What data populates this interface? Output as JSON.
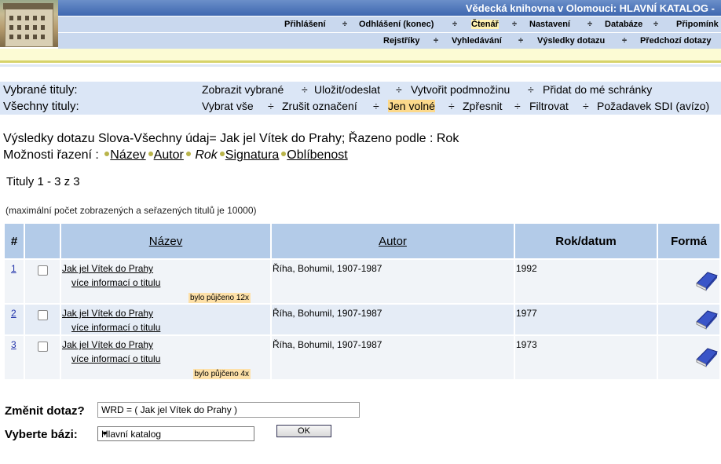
{
  "header": {
    "title": "Vědecká knihovna v Olomouci: HLAVNÍ KATALOG -",
    "nav_row1": [
      "Přihlášení",
      "Odhlášení (konec)",
      "Čtenář",
      "Nastavení",
      "Databáze",
      "Připomínk"
    ],
    "nav_row1_active": "Čtenář",
    "nav_row2": [
      "Rejstříky",
      "Vyhledávání",
      "Výsledky dotazu",
      "Předchozí dotazy"
    ],
    "separator": "÷"
  },
  "selected_bar": {
    "label": "Vybrané tituly:",
    "actions": [
      "Zobrazit vybrané",
      "Uložit/odeslat",
      "Vytvořit podmnožinu",
      "Přidat do mé schránky"
    ]
  },
  "all_bar": {
    "label": "Všechny tituly:",
    "actions": [
      "Vybrat vše",
      "Zrušit označení",
      "Jen volné",
      "Zpřesnit",
      "Filtrovat",
      "Požadavek SDI (avízo)"
    ]
  },
  "query_title": "Výsledky dotazu Slova-Všechny údaj= Jak jel Vítek do Prahy; Řazeno podle : Rok",
  "sort": {
    "label": "Možnosti řazení :",
    "options": [
      "Název",
      "Autor",
      "Rok",
      "Signatura",
      "Oblíbenost"
    ],
    "current": "Rok"
  },
  "count_text": "Tituly 1 - 3 z 3",
  "max_note": "(maximální počet zobrazených a seřazených titulů je 10000)",
  "table": {
    "headers": [
      "#",
      "",
      "Název",
      "Autor",
      "Rok/datum",
      "Formá"
    ],
    "rows": [
      {
        "num": "1",
        "title": "Jak jel Vítek do Prahy",
        "more": "více informací o titulu",
        "borrowed": "bylo půjčeno 12x",
        "author": "Říha, Bohumil, 1907-1987",
        "year": "1992",
        "format_icon": "book-icon"
      },
      {
        "num": "2",
        "title": "Jak jel Vítek do Prahy",
        "more": "více informací o titulu",
        "borrowed": "",
        "author": "Říha, Bohumil, 1907-1987",
        "year": "1977",
        "format_icon": "book-icon"
      },
      {
        "num": "3",
        "title": "Jak jel Vítek do Prahy",
        "more": "více informací o titulu",
        "borrowed": "bylo půjčeno 4x",
        "author": "Říha, Bohumil, 1907-1987",
        "year": "1973",
        "format_icon": "book-icon"
      }
    ]
  },
  "form": {
    "change_label": "Změnit dotaz?",
    "query_value": "WRD = ( Jak jel Vítek do Prahy )",
    "base_label": "Vyberte bázi:",
    "base_value": "Hlavní katalog",
    "ok_label": "OK"
  },
  "colors": {
    "title_bar": "#4a72b8",
    "nav_bg": "#c9d8ee",
    "action_bg": "#dbe6f6",
    "header_cell": "#b3cbe8",
    "highlight": "#fcd98b",
    "borrow_badge": "#fde0a8"
  }
}
